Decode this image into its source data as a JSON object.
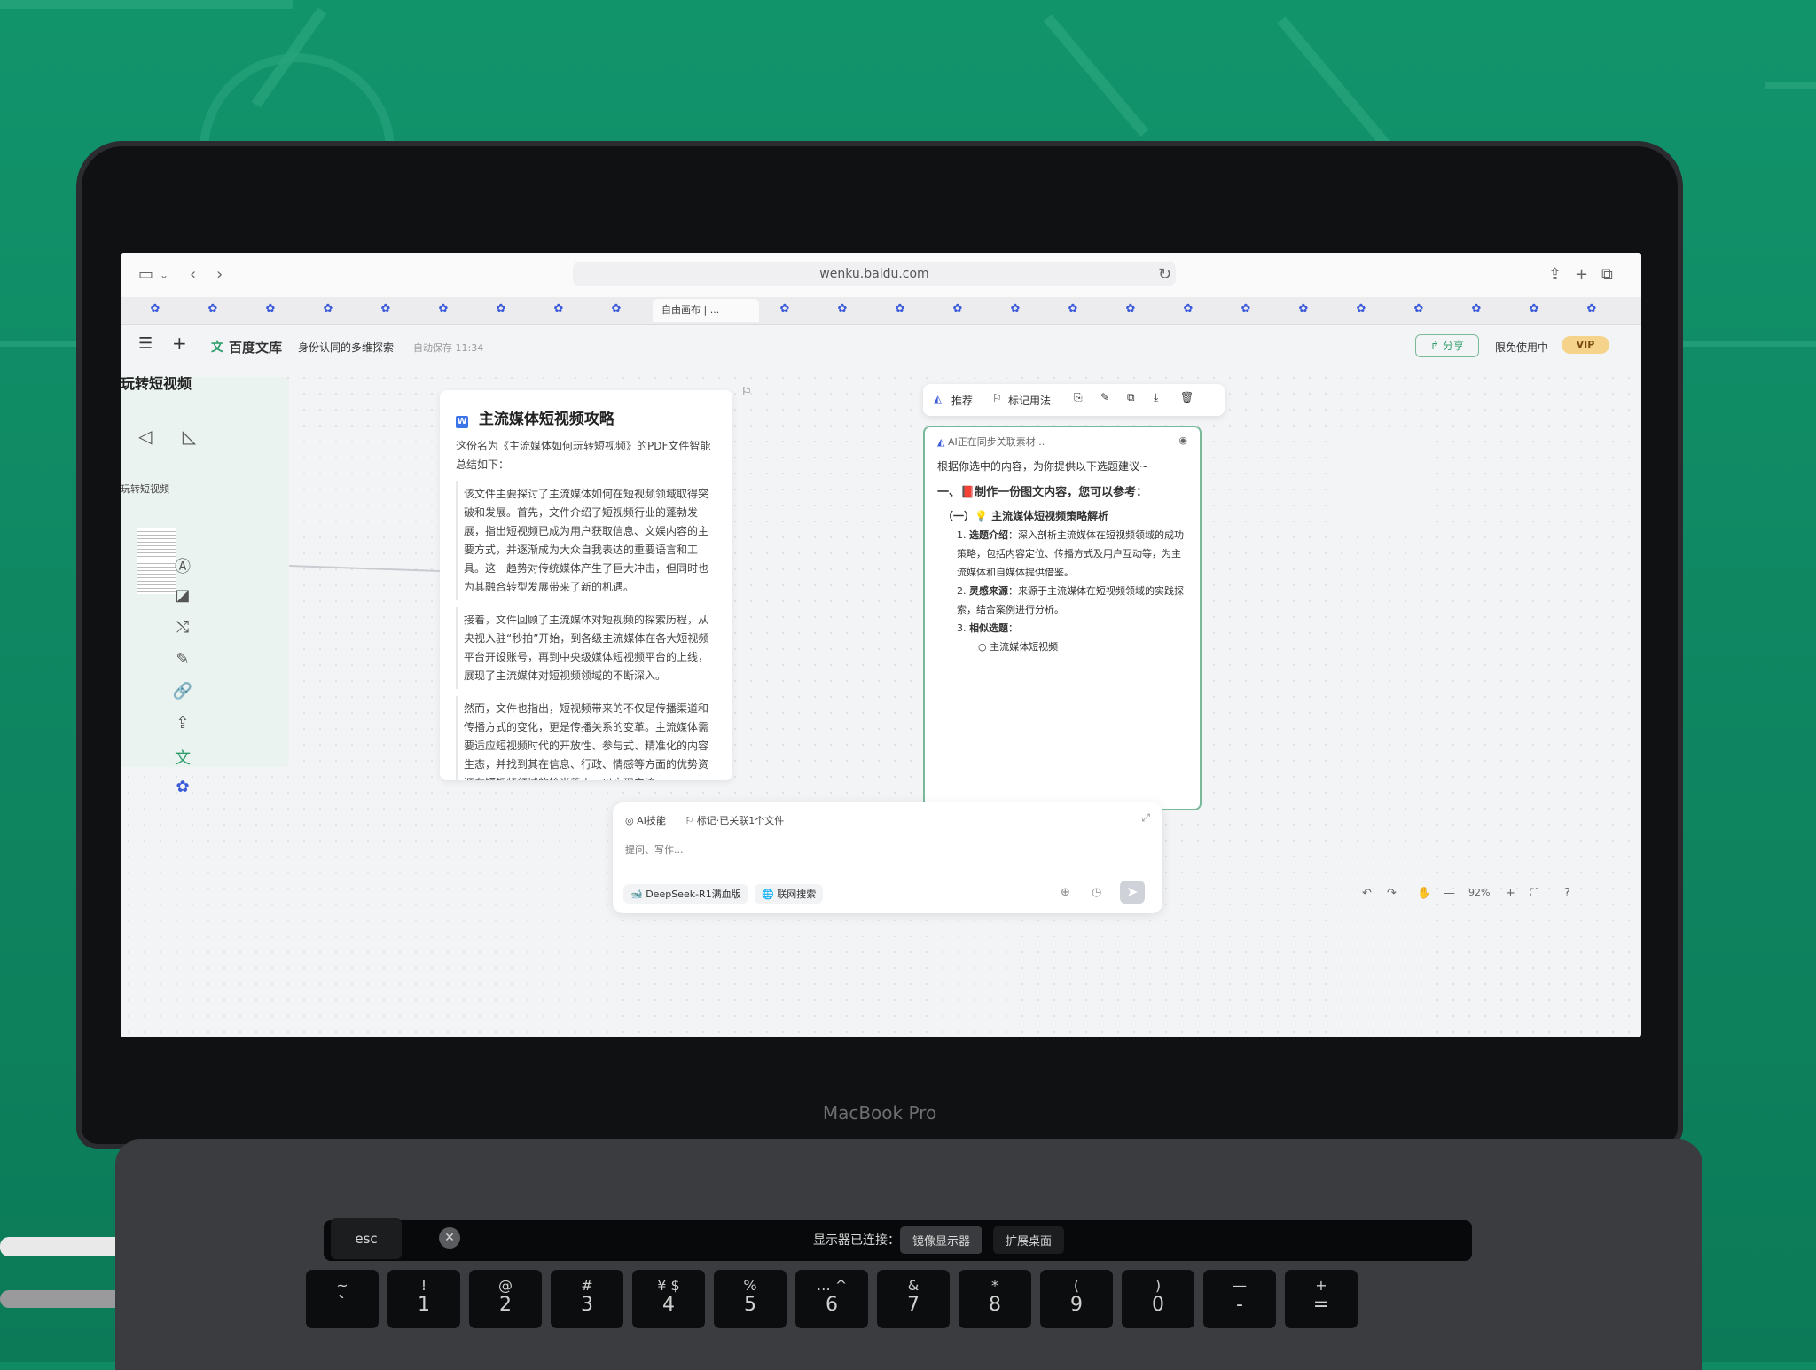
{
  "browser": {
    "url": "wenku.baidu.com",
    "active_tab_label": "自由画布 | ..."
  },
  "app": {
    "logo_text": "百度文库",
    "doc_name": "身份认同的多维探索",
    "autosave": "自动保存 11:34",
    "share_label": "分享",
    "limited_label": "限免使用中",
    "vip_label": "VIP"
  },
  "left_panel": {
    "title": "玩转短视频",
    "thumb_label": "玩转短视频"
  },
  "doc_card": {
    "title": "主流媒体短视频攻略",
    "intro": "这份名为《主流媒体如何玩转短视频》的PDF文件智能总结如下：",
    "para1": "该文件主要探讨了主流媒体如何在短视频领域取得突破和发展。首先，文件介绍了短视频行业的蓬勃发展，指出短视频已成为用户获取信息、文娱内容的主要方式，并逐渐成为大众自我表达的重要语言和工具。这一趋势对传统媒体产生了巨大冲击，但同时也为其融合转型发展带来了新的机遇。",
    "para2": "接着，文件回顾了主流媒体对短视频的探索历程，从央视入驻“秒拍”开始，到各级主流媒体在各大短视频平台开设账号，再到中央级媒体短视频平台的上线，展现了主流媒体对短视频领域的不断深入。",
    "para3": "然而，文件也指出，短视频带来的不仅是传播渠道和传播方式的变化，更是传播关系的变革。主流媒体需要适应短视频时代的开放性、参与式、精准化的内容生态，并找到其在信息、行政、情感等方面的优势资源在短视频领域的恰当落点，以实现主流"
  },
  "ai_toolbar": {
    "recommend": "推荐",
    "mark_usage": "标记用法"
  },
  "ai_card": {
    "status": "AI正在同步关联素材...",
    "lead": "根据你选中的内容，为你提供以下选题建议~",
    "heading": "一、📕制作一份图文内容，您可以参考：",
    "sub_heading": "（一）💡 主流媒体短视频策略解析",
    "item1_label": "选题介绍",
    "item1_text": "：深入剖析主流媒体在短视频领域的成功策略，包括内容定位、传播方式及用户互动等，为主流媒体和自媒体提供借鉴。",
    "item2_label": "灵感来源",
    "item2_text": "：来源于主流媒体在短视频领域的实践探索，结合案例进行分析。",
    "item3_label": "相似选题",
    "item3_text": "：",
    "sub_item": "主流媒体短视频"
  },
  "chat": {
    "skill": "AI技能",
    "mark": "标记·已关联1个文件",
    "placeholder": "提问、写作...",
    "model": "DeepSeek-R1满血版",
    "web_search": "联网搜索"
  },
  "zoom": {
    "level": "92%"
  },
  "laptop": {
    "brand": "MacBook Pro",
    "touchbar_label": "显示器已连接：",
    "mirror": "镜像显示器",
    "extend": "扩展桌面",
    "esc": "esc"
  },
  "keys": [
    {
      "top": "~",
      "bot": "`"
    },
    {
      "top": "!",
      "bot": "1"
    },
    {
      "top": "@",
      "bot": "2"
    },
    {
      "top": "#",
      "bot": "3"
    },
    {
      "top": "¥ $",
      "bot": "4"
    },
    {
      "top": "%",
      "bot": "5"
    },
    {
      "top": "… ^",
      "bot": "6"
    },
    {
      "top": "&",
      "bot": "7"
    },
    {
      "top": "*",
      "bot": "8"
    },
    {
      "top": "(",
      "bot": "9"
    },
    {
      "top": ")",
      "bot": "0"
    },
    {
      "top": "—",
      "bot": "-"
    },
    {
      "top": "+",
      "bot": "="
    }
  ]
}
